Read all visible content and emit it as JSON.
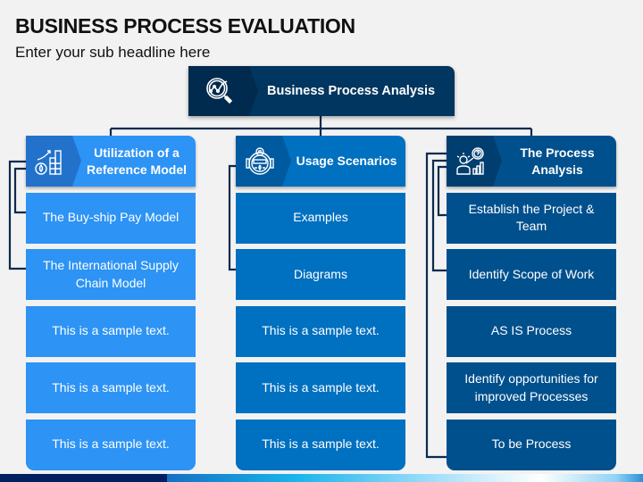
{
  "title": "BUSINESS PROCESS EVALUATION",
  "subtitle": "Enter your sub headline here",
  "root": {
    "label": "Business Process Analysis",
    "icon": "magnifier-chart-icon"
  },
  "columns": [
    {
      "header": "Utilization of a Reference Model",
      "icon": "growth-chart-drop-icon",
      "color": "#2d93f5",
      "items": [
        "The Buy-ship Pay Model",
        "The International Supply Chain Model",
        "This is a sample text.",
        "This is a sample text.",
        "This is a sample text."
      ]
    },
    {
      "header": "Usage Scenarios",
      "icon": "meter-device-icon",
      "color": "#0070c0",
      "items": [
        "Examples",
        "Diagrams",
        "This is a sample text.",
        "This is a sample text.",
        "This is a sample text."
      ]
    },
    {
      "header": "The Process Analysis",
      "icon": "analyst-idea-chart-icon",
      "color": "#00508d",
      "items": [
        "Establish the Project & Team",
        "Identify Scope of Work",
        "AS IS Process",
        "Identify opportunities for improved Processes",
        "To be Process"
      ]
    }
  ],
  "colors": {
    "root": "#00365f",
    "connector": "#0c2a4e"
  }
}
